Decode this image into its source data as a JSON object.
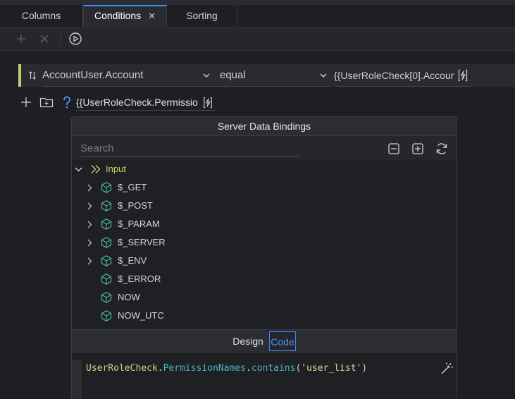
{
  "tabs": [
    {
      "label": "Columns"
    },
    {
      "label": "Conditions",
      "close": "✕"
    },
    {
      "label": "Sorting"
    }
  ],
  "condition": {
    "field": "AccountUser.Account",
    "operator": "equal",
    "value": "{{UserRoleCheck[0].Accour"
  },
  "row2": {
    "expression": "{{UserRoleCheck.Permissio"
  },
  "panel": {
    "title": "Server Data Bindings",
    "search_placeholder": "Search",
    "tree": {
      "root": "Input",
      "items": [
        {
          "label": "$_GET",
          "expandable": true
        },
        {
          "label": "$_POST",
          "expandable": true
        },
        {
          "label": "$_PARAM",
          "expandable": true
        },
        {
          "label": "$_SERVER",
          "expandable": true
        },
        {
          "label": "$_ENV",
          "expandable": true
        },
        {
          "label": "$_ERROR",
          "expandable": false
        },
        {
          "label": "NOW",
          "expandable": false
        },
        {
          "label": "NOW_UTC",
          "expandable": false
        }
      ]
    },
    "modes": {
      "design": "Design",
      "code": "Code",
      "active": "Code"
    },
    "code": {
      "object": "UserRoleCheck",
      "dot1": ".",
      "prop1": "PermissionNames",
      "dot2": ".",
      "method": "contains",
      "open": "(",
      "string": "'user_list'",
      "close": ")"
    }
  },
  "colors": {
    "accent": "#3f86ff",
    "condition_bar": "#c8cc6e",
    "input_node": "#c8d46e",
    "cube": "#4fb3a8"
  }
}
